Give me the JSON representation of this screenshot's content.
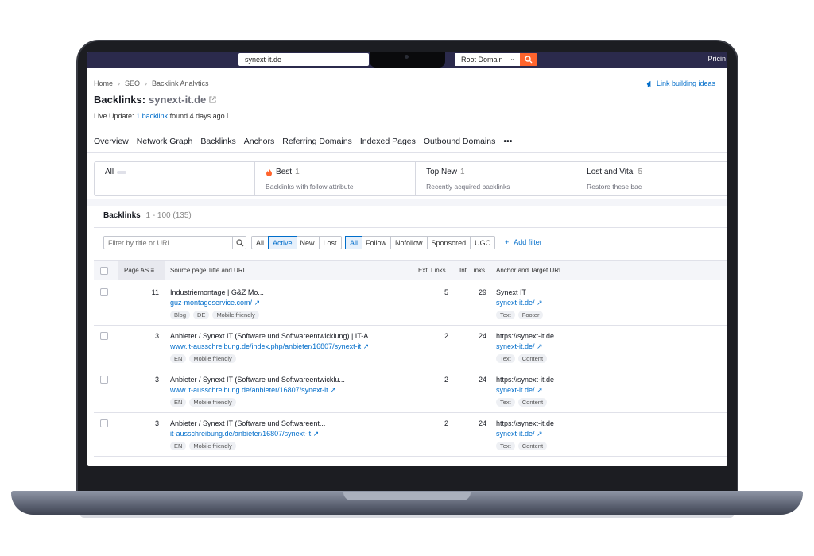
{
  "topbar": {
    "domain": "synext-it.de",
    "scope": "Root Domain",
    "pricing": "Pricin"
  },
  "breadcrumb": [
    "Home",
    "SEO",
    "Backlink Analytics"
  ],
  "link_ideas": "Link building ideas",
  "title": {
    "label": "Backlinks:",
    "domain": "synext-it.de"
  },
  "live_update": {
    "prefix": "Live Update:",
    "link": "1 backlink",
    "suffix": "found 4 days ago"
  },
  "tabs": [
    "Overview",
    "Network Graph",
    "Backlinks",
    "Anchors",
    "Referring Domains",
    "Indexed Pages",
    "Outbound Domains",
    "•••"
  ],
  "active_tab": "Backlinks",
  "cards": [
    {
      "title": "All",
      "count": "",
      "sub": ""
    },
    {
      "title": "Best",
      "count": "1",
      "sub": "Backlinks with follow attribute"
    },
    {
      "title": "Top New",
      "count": "1",
      "sub": "Recently acquired backlinks"
    },
    {
      "title": "Lost and Vital",
      "count": "5",
      "sub": "Restore these bac"
    }
  ],
  "backlinks": {
    "label": "Backlinks",
    "range": "1 - 100 (135)"
  },
  "filter": {
    "placeholder": "Filter by title or URL"
  },
  "status_seg": [
    "All",
    "Active",
    "New",
    "Lost"
  ],
  "status_selected": "Active",
  "type_seg": [
    "All",
    "Follow",
    "Nofollow",
    "Sponsored",
    "UGC"
  ],
  "type_selected": "All",
  "add_filter": "Add filter",
  "columns": {
    "page_as": "Page AS",
    "source": "Source page Title and URL",
    "ext": "Ext. Links",
    "int": "Int. Links",
    "anchor": "Anchor and Target URL"
  },
  "rows": [
    {
      "as": "11",
      "title": "Industriemontage | G&Z Mo...",
      "url": "guz-montageservice.com/",
      "tags": [
        "Blog",
        "DE",
        "Mobile friendly"
      ],
      "ext": "5",
      "int": "29",
      "anchor": "Synext IT",
      "target": "synext-it.de/",
      "atags": [
        "Text",
        "Footer"
      ]
    },
    {
      "as": "3",
      "title": "Anbieter / Synext IT (Software und Softwareentwicklung) | IT-A...",
      "url": "www.it-ausschreibung.de/index.php/anbieter/16807/synext-it",
      "tags": [
        "EN",
        "Mobile friendly"
      ],
      "ext": "2",
      "int": "24",
      "anchor": "https://synext-it.de",
      "target": "synext-it.de/",
      "atags": [
        "Text",
        "Content"
      ]
    },
    {
      "as": "3",
      "title": "Anbieter / Synext IT (Software und Softwareentwicklu...",
      "url": "www.it-ausschreibung.de/anbieter/16807/synext-it",
      "tags": [
        "EN",
        "Mobile friendly"
      ],
      "ext": "2",
      "int": "24",
      "anchor": "https://synext-it.de",
      "target": "synext-it.de/",
      "atags": [
        "Text",
        "Content"
      ]
    },
    {
      "as": "3",
      "title": "Anbieter / Synext IT (Software und Softwareent...",
      "url": "it-ausschreibung.de/anbieter/16807/synext-it",
      "tags": [
        "EN",
        "Mobile friendly"
      ],
      "ext": "2",
      "int": "24",
      "anchor": "https://synext-it.de",
      "target": "synext-it.de/",
      "atags": [
        "Text",
        "Content"
      ]
    }
  ],
  "colors": {
    "accent": "#006dca",
    "topbar": "#2b2a4c",
    "search": "#ff642d"
  }
}
